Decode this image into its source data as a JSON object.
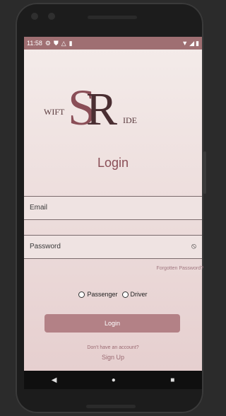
{
  "status_bar": {
    "time": "11:58",
    "icons_left": [
      "gear-icon",
      "shield-icon",
      "alert-triangle-icon",
      "sim-icon"
    ],
    "icons_right": [
      "wifi-icon",
      "signal-icon",
      "battery-icon"
    ]
  },
  "logo": {
    "prefix": "WIFT",
    "letters": "SR",
    "suffix": "IDE"
  },
  "title": "Login",
  "email_label": "Email",
  "password_label": "Password",
  "forgot_label": "Forgotten Password?",
  "roles": {
    "passenger": "Passenger",
    "driver": "Driver"
  },
  "login_button": "Login",
  "noaccount_text": "Don't have an account?",
  "signup_text": "Sign Up",
  "nav": {
    "back": "◀",
    "home": "●",
    "recent": "■"
  },
  "colors": {
    "accent": "#b38186",
    "status_bar": "#9f6f72",
    "text_muted": "#9a6a72"
  }
}
